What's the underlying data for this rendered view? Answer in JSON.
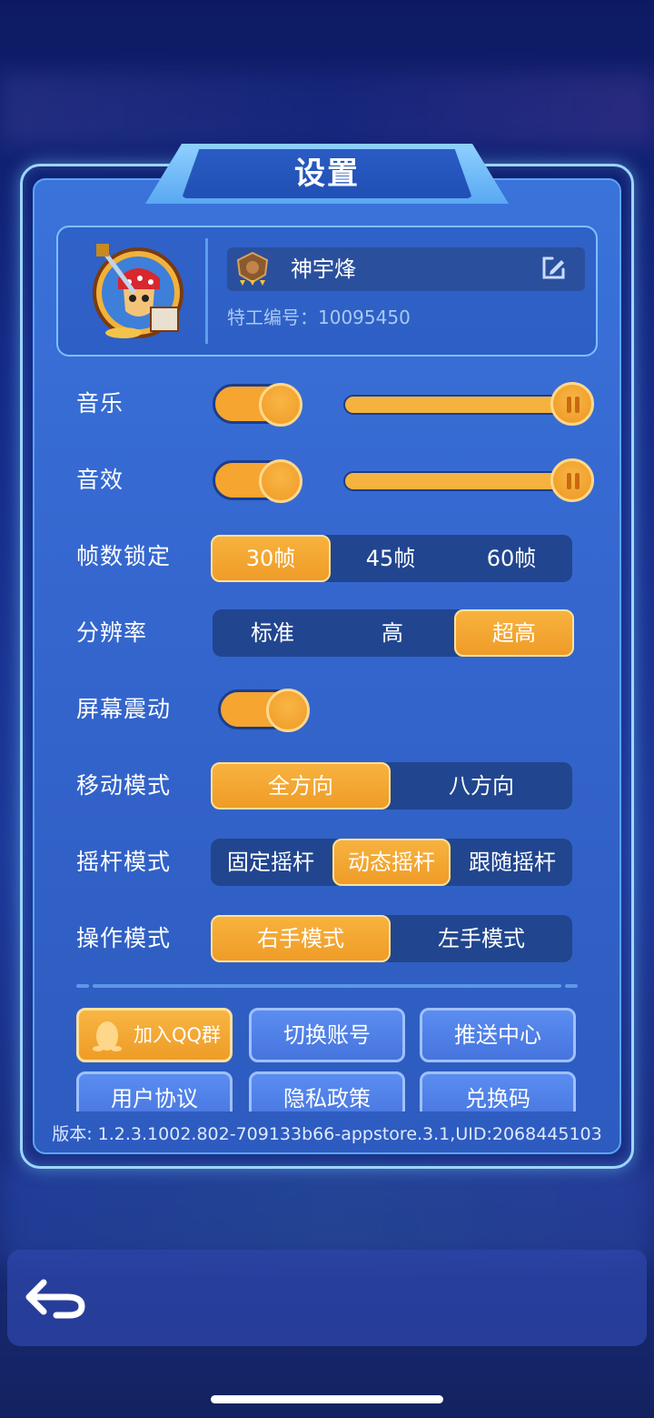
{
  "title": "设置",
  "profile": {
    "name": "神宇烽",
    "agent_id": "特工编号：10095450"
  },
  "settings": {
    "music_label": "音乐",
    "sfx_label": "音效",
    "music_volume": 1.0,
    "sfx_volume": 1.0,
    "music_enabled": true,
    "sfx_enabled": true,
    "fps_label": "帧数锁定",
    "fps_options": [
      "30帧",
      "45帧",
      "60帧"
    ],
    "fps_selected": "30帧",
    "resolution_label": "分辨率",
    "resolution_options": [
      "标准",
      "高",
      "超高"
    ],
    "resolution_selected": "超高",
    "shake_label": "屏幕震动",
    "shake_enabled": true,
    "move_label": "移动模式",
    "move_options": [
      "全方向",
      "八方向"
    ],
    "move_selected": "全方向",
    "joystick_label": "摇杆模式",
    "joystick_options": [
      "固定摇杆",
      "动态摇杆",
      "跟随摇杆"
    ],
    "joystick_selected": "动态摇杆",
    "control_label": "操作模式",
    "control_options": [
      "右手模式",
      "左手模式"
    ],
    "control_selected": "右手模式"
  },
  "buttons": {
    "join_qq": "加入QQ群",
    "switch_account": "切换账号",
    "push_center": "推送中心",
    "user_agreement": "用户协议",
    "privacy_policy": "隐私政策",
    "redeem_code": "兑换码"
  },
  "version": "版本: 1.2.3.1002.802-709133b66-appstore.3.1,UID:2068445103",
  "colors": {
    "accent_orange": "#f5a530",
    "panel_blue": "#3567cf",
    "border_light": "#9dd6ff"
  },
  "icons": {
    "edit": "edit-icon",
    "back": "back-arrow-icon",
    "qq": "qq-penguin-icon",
    "rank": "rank-badge-icon"
  }
}
